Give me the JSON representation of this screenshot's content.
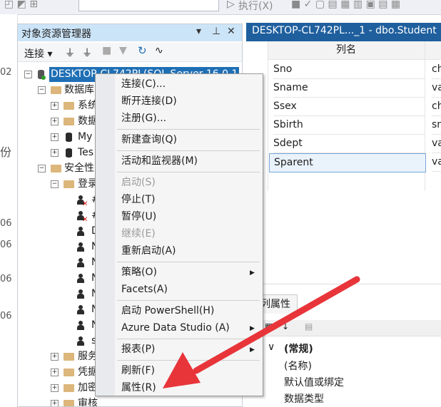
{
  "toolbar": {
    "execute_label": "执行(X)"
  },
  "gutter_fragments": [
    "02",
    "份",
    "06",
    "06",
    "06",
    "06"
  ],
  "object_explorer": {
    "title": "对象资源管理器",
    "connect_label": "连接",
    "tree": {
      "server": "DESKTOP-CL742PL(SQL Server 16.0.1",
      "databases": "数据库",
      "sys_db": "系统",
      "db_snap": "数据",
      "my": "My",
      "tes": "Tes",
      "security": "安全性",
      "logins": "登录",
      "login_items": [
        "#",
        "#",
        "D",
        "N",
        "N",
        "N",
        "N",
        "N",
        "N",
        "s"
      ],
      "services": "服务",
      "credentials": "凭据",
      "encrypt": "加密",
      "audit": "审核"
    }
  },
  "editor": {
    "tab_title": "DESKTOP-CL742PL..._1 - dbo.Student",
    "column_header": "列名",
    "rows": [
      {
        "name": "Sno",
        "type": "ch"
      },
      {
        "name": "Sname",
        "type": "va"
      },
      {
        "name": "Ssex",
        "type": "ch"
      },
      {
        "name": "Sbirth",
        "type": "sn"
      },
      {
        "name": "Sdept",
        "type": "va"
      },
      {
        "name": "Sparent",
        "type": "va"
      }
    ]
  },
  "properties": {
    "tab": "列属性",
    "group": "(常规)",
    "items": [
      "(名称)",
      "默认值或绑定",
      "数据类型"
    ]
  },
  "context_menu": {
    "items": [
      {
        "label": "连接(C)..."
      },
      {
        "label": "断开连接(D)"
      },
      {
        "label": "注册(G)..."
      },
      {
        "label": "新建查询(Q)"
      },
      {
        "label": "活动和监视器(M)"
      },
      {
        "label": "启动(S)"
      },
      {
        "label": "停止(T)"
      },
      {
        "label": "暂停(U)"
      },
      {
        "label": "继续(E)"
      },
      {
        "label": "重新启动(A)"
      },
      {
        "label": "策略(O)"
      },
      {
        "label": "Facets(A)"
      },
      {
        "label": "启动 PowerShell(H)"
      },
      {
        "label": "Azure Data Studio (A)"
      },
      {
        "label": "报表(P)"
      },
      {
        "label": "刷新(F)"
      },
      {
        "label": "属性(R)"
      }
    ]
  },
  "colors": {
    "accent": "#1f5f9e",
    "arrow": "#e8353a",
    "selection": "#cce4f7"
  }
}
